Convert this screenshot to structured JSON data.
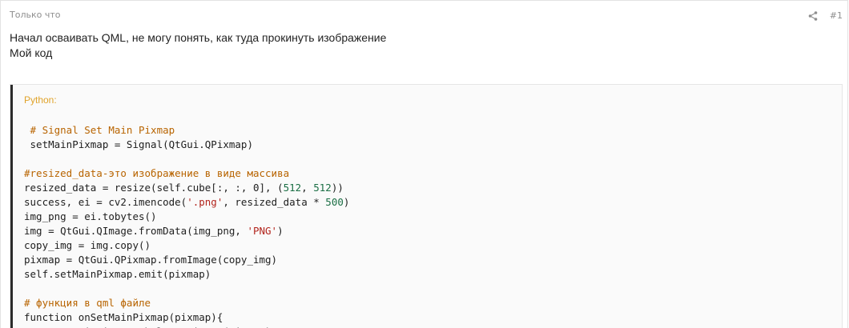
{
  "header": {
    "timestamp": "Только что",
    "post_number": "#1",
    "share_icon": "share-icon"
  },
  "post": {
    "lines": [
      "Начал осваивать QML, не могу понять, как туда прокинуть изображение",
      "Мой код"
    ]
  },
  "code": {
    "language": "Python:",
    "lines": [
      [
        {
          "t": " # Signal Set Main Pixmap",
          "k": "comment"
        }
      ],
      [
        {
          "t": " setMainPixmap = Signal(QtGui.QPixmap)",
          "k": "plain"
        }
      ],
      [],
      [
        {
          "t": "#resized_data-это изображение в виде массива",
          "k": "comment"
        }
      ],
      [
        {
          "t": "resized_data = resize(self.cube[:, :, 0], (",
          "k": "plain"
        },
        {
          "t": "512",
          "k": "number"
        },
        {
          "t": ", ",
          "k": "plain"
        },
        {
          "t": "512",
          "k": "number"
        },
        {
          "t": "))",
          "k": "plain"
        }
      ],
      [
        {
          "t": "success, ei = cv2.imencode(",
          "k": "plain"
        },
        {
          "t": "'.png'",
          "k": "string"
        },
        {
          "t": ", resized_data * ",
          "k": "plain"
        },
        {
          "t": "500",
          "k": "number"
        },
        {
          "t": ")",
          "k": "plain"
        }
      ],
      [
        {
          "t": "img_png = ei.tobytes()",
          "k": "plain"
        }
      ],
      [
        {
          "t": "img = QtGui.QImage.fromData(img_png, ",
          "k": "plain"
        },
        {
          "t": "'PNG'",
          "k": "string"
        },
        {
          "t": ")",
          "k": "plain"
        }
      ],
      [
        {
          "t": "copy_img = img.copy()",
          "k": "plain"
        }
      ],
      [
        {
          "t": "pixmap = QtGui.QPixmap.fromImage(copy_img)",
          "k": "plain"
        }
      ],
      [
        {
          "t": "self.setMainPixmap.emit(pixmap)",
          "k": "plain"
        }
      ],
      [],
      [
        {
          "t": "# функция в qml файле",
          "k": "comment"
        }
      ],
      [
        {
          "t": "function onSetMainPixmap(pixmap){",
          "k": "plain"
        }
      ],
      [
        {
          "t": "        mainPixmapLabel.setPixmap(pixmap)",
          "k": "plain"
        }
      ]
    ]
  },
  "colors": {
    "language_label": "#e0a32a",
    "comment": "#b86400",
    "string": "#b2241c",
    "number": "#1a6e44",
    "accent_bar": "#2b2b2b"
  }
}
